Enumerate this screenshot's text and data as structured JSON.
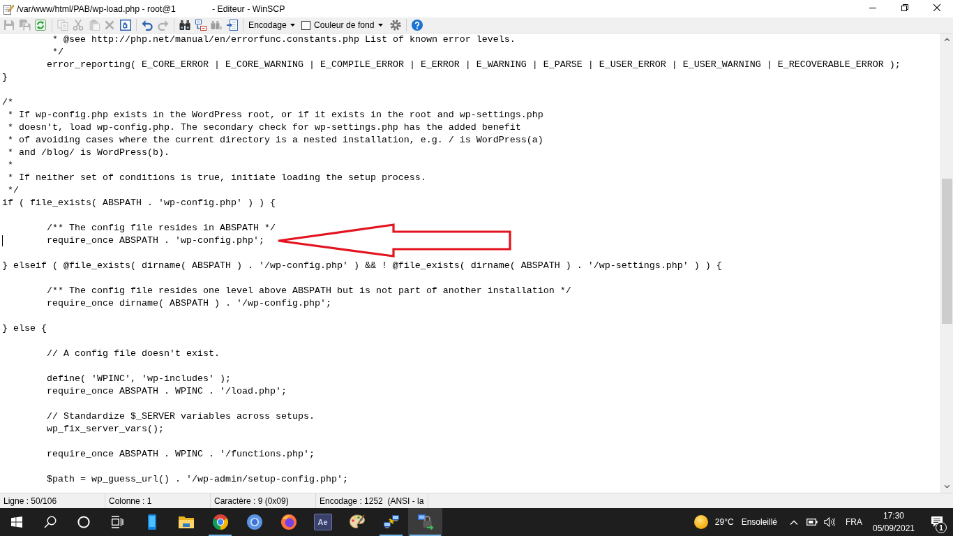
{
  "window": {
    "title_start": "/var/www/html/PAB/wp-load.php - root@1",
    "title_end": "- Editeur - WinSCP"
  },
  "toolbar": {
    "groups": [
      {
        "items": [
          {
            "kind": "icon",
            "disabled": true
          },
          {
            "kind": "icon",
            "disabled": true
          },
          {
            "kind": "icon",
            "disabled": false
          }
        ]
      },
      {
        "items": [
          {
            "kind": "icon",
            "disabled": true
          },
          {
            "kind": "icon",
            "disabled": true
          },
          {
            "kind": "icon",
            "disabled": true
          },
          {
            "kind": "icon",
            "disabled": true
          },
          {
            "kind": "icon",
            "disabled": false
          }
        ]
      },
      {
        "items": [
          {
            "kind": "icon",
            "disabled": false
          },
          {
            "kind": "icon",
            "disabled": true
          }
        ]
      },
      {
        "items": [
          {
            "kind": "icon",
            "disabled": false
          },
          {
            "kind": "icon",
            "disabled": false
          },
          {
            "kind": "icon",
            "disabled": true
          },
          {
            "kind": "icon",
            "disabled": false
          }
        ]
      },
      {
        "items": [
          {
            "kind": "dropdown",
            "label": "Encodage"
          },
          {
            "kind": "checkbox",
            "label": "Couleur de fond",
            "checked": false
          },
          {
            "kind": "icon",
            "disabled": false
          }
        ]
      },
      {
        "items": [
          {
            "kind": "icon",
            "disabled": false
          }
        ]
      }
    ]
  },
  "editor": {
    "blocks": [
      {
        "lines": [
          {
            "text": "\t * @see http://php.net/manual/en/errorfunc.constants.php List of known error levels.",
            "cursor": false
          },
          {
            "text": "\t */",
            "cursor": false
          },
          {
            "text": "\terror_reporting( E_CORE_ERROR | E_CORE_WARNING | E_COMPILE_ERROR | E_ERROR | E_WARNING | E_PARSE | E_USER_ERROR | E_USER_WARNING | E_RECOVERABLE_ERROR );",
            "cursor": false
          },
          {
            "text": "}",
            "cursor": false
          }
        ]
      },
      {
        "lines": [
          {
            "text": "/*",
            "cursor": false
          },
          {
            "text": " * If wp-config.php exists in the WordPress root, or if it exists in the root and wp-settings.php",
            "cursor": false
          },
          {
            "text": " * doesn't, load wp-config.php. The secondary check for wp-settings.php has the added benefit",
            "cursor": false
          },
          {
            "text": " * of avoiding cases where the current directory is a nested installation, e.g. / is WordPress(a)",
            "cursor": false
          },
          {
            "text": " * and /blog/ is WordPress(b).",
            "cursor": false
          },
          {
            "text": " *",
            "cursor": false
          },
          {
            "text": " * If neither set of conditions is true, initiate loading the setup process.",
            "cursor": false
          },
          {
            "text": " */",
            "cursor": false
          },
          {
            "text": "if ( file_exists( ABSPATH . 'wp-config.php' ) ) {",
            "cursor": false
          }
        ]
      },
      {
        "lines": [
          {
            "text": "\t/** The config file resides in ABSPATH */",
            "cursor": false
          },
          {
            "text": "\trequire_once ABSPATH . 'wp-config.php';",
            "cursor": true
          }
        ]
      },
      {
        "lines": [
          {
            "text": "} elseif ( @file_exists( dirname( ABSPATH ) . '/wp-config.php' ) && ! @file_exists( dirname( ABSPATH ) . '/wp-settings.php' ) ) {",
            "cursor": false
          }
        ]
      },
      {
        "lines": [
          {
            "text": "\t/** The config file resides one level above ABSPATH but is not part of another installation */",
            "cursor": false
          },
          {
            "text": "\trequire_once dirname( ABSPATH ) . '/wp-config.php';",
            "cursor": false
          }
        ]
      },
      {
        "lines": [
          {
            "text": "} else {",
            "cursor": false
          }
        ]
      },
      {
        "lines": [
          {
            "text": "\t// A config file doesn't exist.",
            "cursor": false
          }
        ]
      },
      {
        "lines": [
          {
            "text": "\tdefine( 'WPINC', 'wp-includes' );",
            "cursor": false
          },
          {
            "text": "\trequire_once ABSPATH . WPINC . '/load.php';",
            "cursor": false
          }
        ]
      },
      {
        "lines": [
          {
            "text": "\t// Standardize $_SERVER variables across setups.",
            "cursor": false
          },
          {
            "text": "\twp_fix_server_vars();",
            "cursor": false
          }
        ]
      },
      {
        "lines": [
          {
            "text": "\trequire_once ABSPATH . WPINC . '/functions.php';",
            "cursor": false
          }
        ]
      },
      {
        "lines": [
          {
            "text": "\t$path = wp_guess_url() . '/wp-admin/setup-config.php';",
            "cursor": false
          }
        ]
      }
    ]
  },
  "status_bar": {
    "panes": [
      "Ligne : 50/106",
      "Colonne : 1",
      "Caractère : 9 (0x09)",
      "Encodage : 1252  (ANSI - la"
    ]
  },
  "taskbar": {
    "apps": [
      {
        "running": false,
        "selected": false
      },
      {
        "running": false,
        "selected": false
      },
      {
        "running": true,
        "selected": false
      },
      {
        "running": false,
        "selected": false
      },
      {
        "running": false,
        "selected": false
      },
      {
        "label": "Ae",
        "running": false,
        "selected": false
      },
      {
        "running": false,
        "selected": false
      },
      {
        "running": true,
        "selected": false
      },
      {
        "running": true,
        "selected": true
      }
    ],
    "weather": {
      "temperature": "29°C",
      "condition": "Ensoleillé"
    },
    "language": "FRA",
    "clock": {
      "time": "17:30",
      "date": "05/09/2021"
    },
    "notification_count": "1"
  }
}
